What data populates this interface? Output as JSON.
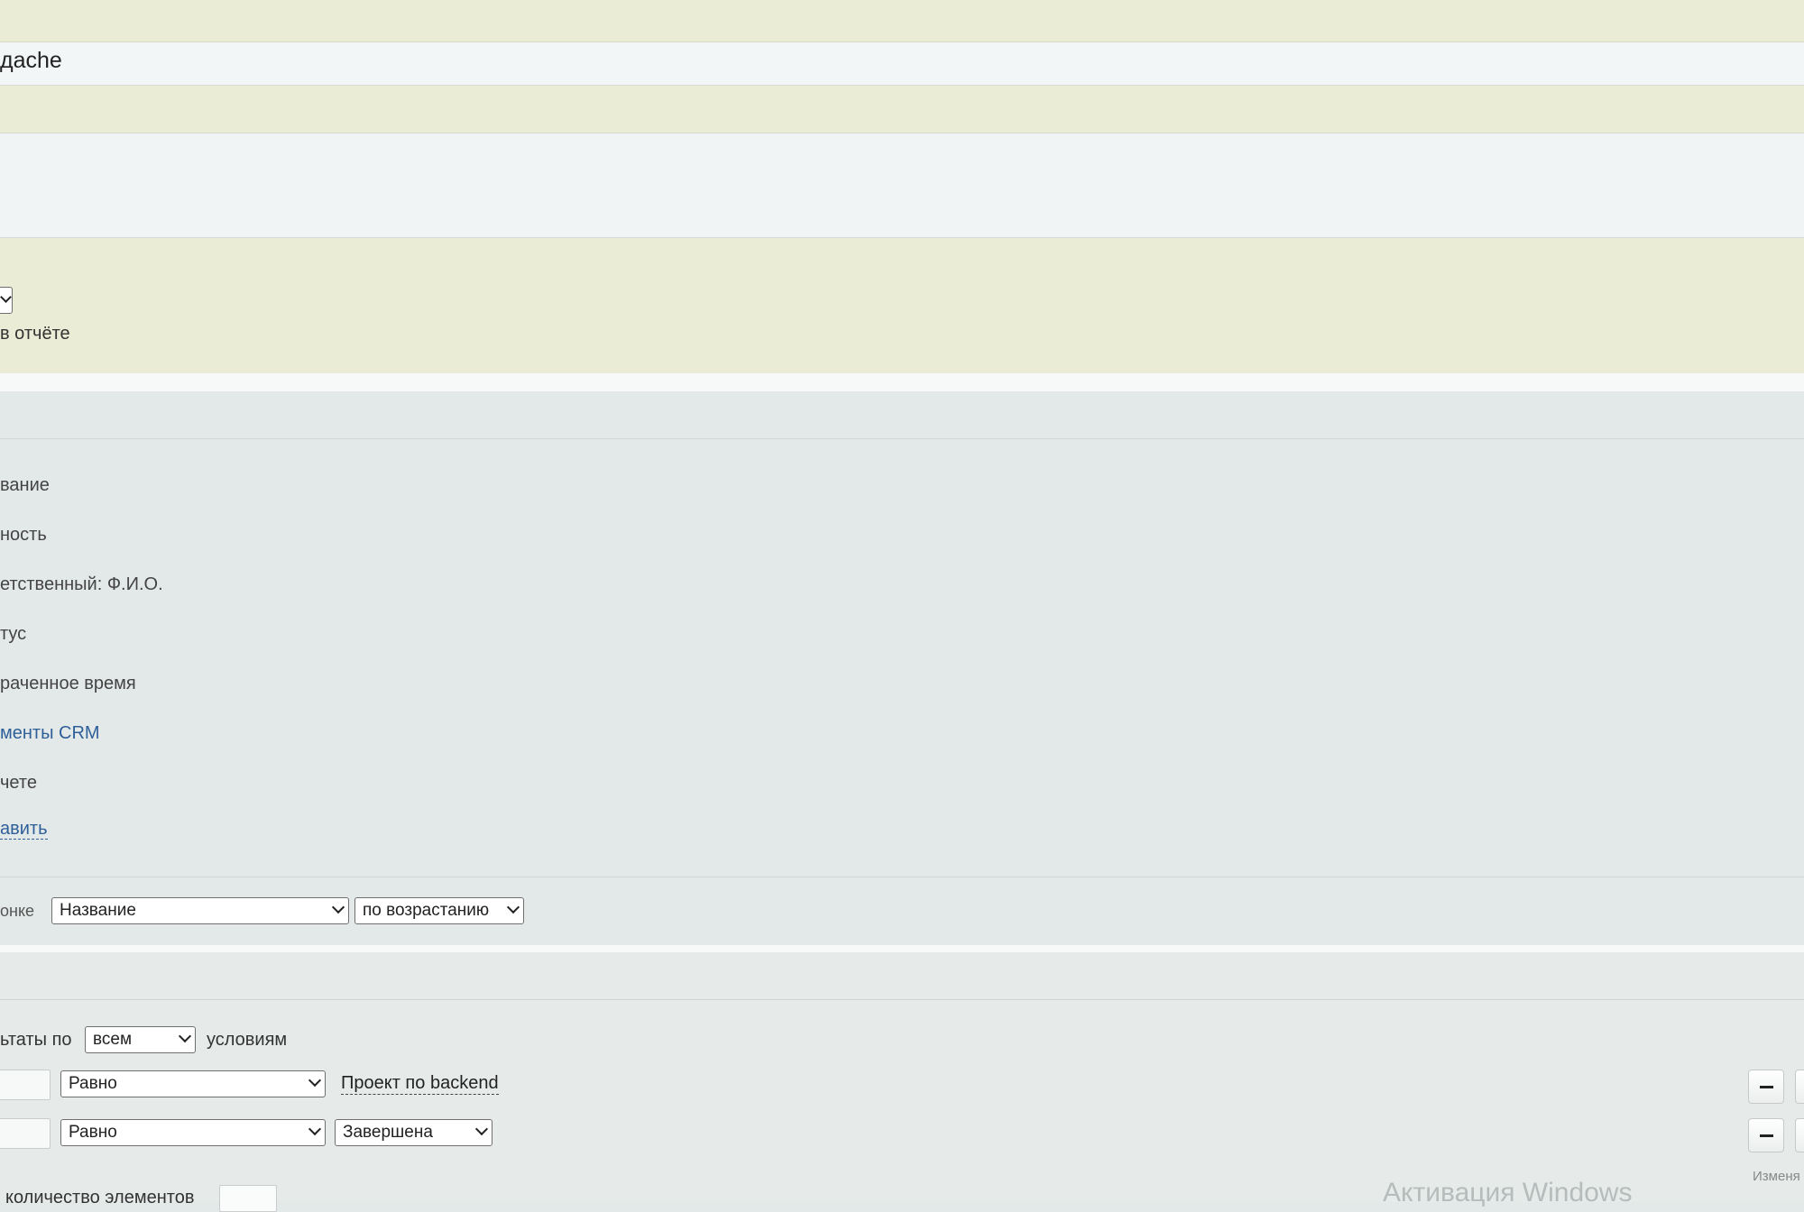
{
  "task_header": {
    "title": "дache"
  },
  "report_options": {
    "show_label": "в отчёте"
  },
  "columns": {
    "items": [
      {
        "label": "вание"
      },
      {
        "label": "ность"
      },
      {
        "label": "етственный: Ф.И.О."
      },
      {
        "label": "тус"
      },
      {
        "label": "раченное время"
      },
      {
        "label": "менты CRM"
      },
      {
        "label": "чете"
      }
    ],
    "add_link": "авить"
  },
  "sort": {
    "label": "онке",
    "column_value": "Название",
    "order_value": "по возрастанию"
  },
  "filter": {
    "prefix": "ьтаты по",
    "mode_value": "всем",
    "suffix": "условиям",
    "conditions": [
      {
        "operator": "Равно",
        "value": "Проект по backend"
      },
      {
        "operator": "Равно",
        "value": "Завершена"
      }
    ],
    "limit_label": "количество элементов",
    "changed_label": "Изменя"
  },
  "overlay": {
    "watermark": "Активация Windows"
  },
  "colors": {
    "header_band": "#eaecd6",
    "light_band": "#f3f6f6",
    "options_band": "#ebecd6",
    "columns_band": "#e3e9e8",
    "link": "#2e5f99"
  }
}
